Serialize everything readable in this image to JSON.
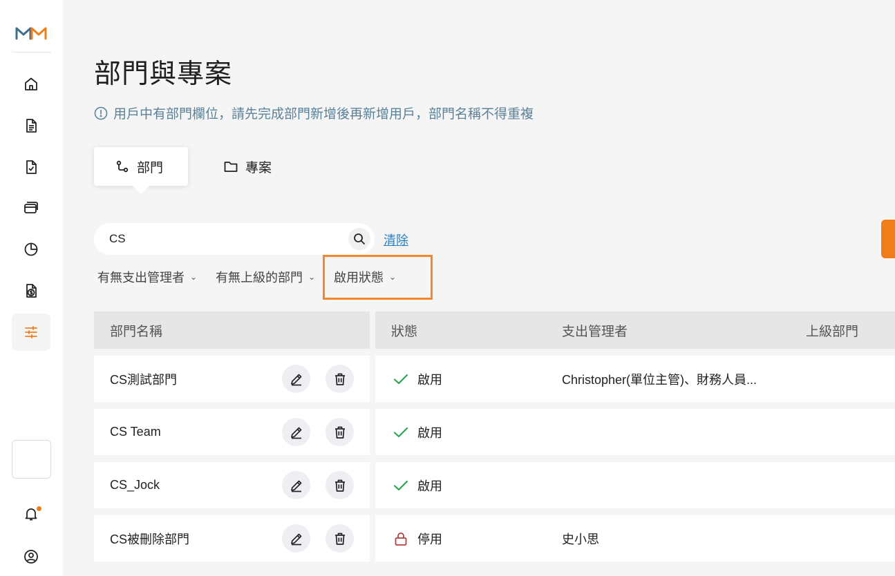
{
  "page": {
    "title": "部門與專案",
    "notice": "用戶中有部門欄位，請先完成部門新增後再新增用戶，部門名稱不得重複"
  },
  "tabs": [
    {
      "label": "部門",
      "icon": "git-branch-icon",
      "active": true
    },
    {
      "label": "專案",
      "icon": "folder-icon",
      "active": false
    }
  ],
  "search": {
    "value": "CS",
    "clear_label": "清除"
  },
  "filters": [
    {
      "label": "有無支出管理者"
    },
    {
      "label": "有無上級的部門"
    },
    {
      "label": "啟用狀態"
    }
  ],
  "table": {
    "columns": [
      "部門名稱",
      "狀態",
      "支出管理者",
      "上級部門"
    ],
    "rows": [
      {
        "name": "CS測試部門",
        "status": "啟用",
        "status_icon": "check-icon",
        "manager": "Christopher(單位主管)、財務人員...",
        "parent": ""
      },
      {
        "name": "CS Team",
        "status": "啟用",
        "status_icon": "check-icon",
        "manager": "",
        "parent": ""
      },
      {
        "name": "CS_Jock",
        "status": "啟用",
        "status_icon": "check-icon",
        "manager": "",
        "parent": ""
      },
      {
        "name": "CS被刪除部門",
        "status": "停用",
        "status_icon": "lock-icon",
        "manager": "史小思",
        "parent": ""
      }
    ]
  },
  "colors": {
    "accent": "#f07d1a",
    "link": "#2b7fc0",
    "notice": "#5a8299",
    "enabled": "#2aa44f",
    "disabled": "#b0413e"
  }
}
